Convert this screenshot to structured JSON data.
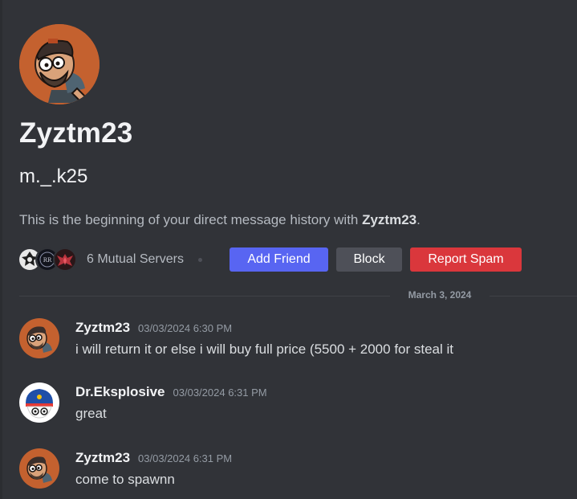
{
  "profile": {
    "display_name": "Zyztm23",
    "username": "m._.k25",
    "intro_prefix": "This is the beginning of your direct message history with ",
    "intro_name": "Zyztm23",
    "intro_suffix": "."
  },
  "mutual": {
    "label": "6 Mutual Servers",
    "icons": [
      "eye-emblem-server-icon",
      "round-text-server-icon",
      "red-winged-server-icon"
    ]
  },
  "actions": {
    "add_friend": "Add Friend",
    "block": "Block",
    "report_spam": "Report Spam"
  },
  "colors": {
    "background": "#313338",
    "blurple": "#5865f2",
    "danger": "#da373c",
    "secondary": "#4e5058",
    "avatar_orange": "#c4612f"
  },
  "divider": {
    "date": "March 3, 2024"
  },
  "messages": [
    {
      "author": "Zyztm23",
      "time": "03/03/2024 6:30 PM",
      "text": "i will return it or else i will buy full price (5500 + 2000 for steal it",
      "avatar": "orange-character-avatar"
    },
    {
      "author": "Dr.Eksplosive",
      "time": "03/03/2024 6:31 PM",
      "text": "great",
      "avatar": "flag-ball-avatar"
    },
    {
      "author": "Zyztm23",
      "time": "03/03/2024 6:31 PM",
      "text": "come to spawnn",
      "avatar": "orange-character-avatar"
    }
  ]
}
